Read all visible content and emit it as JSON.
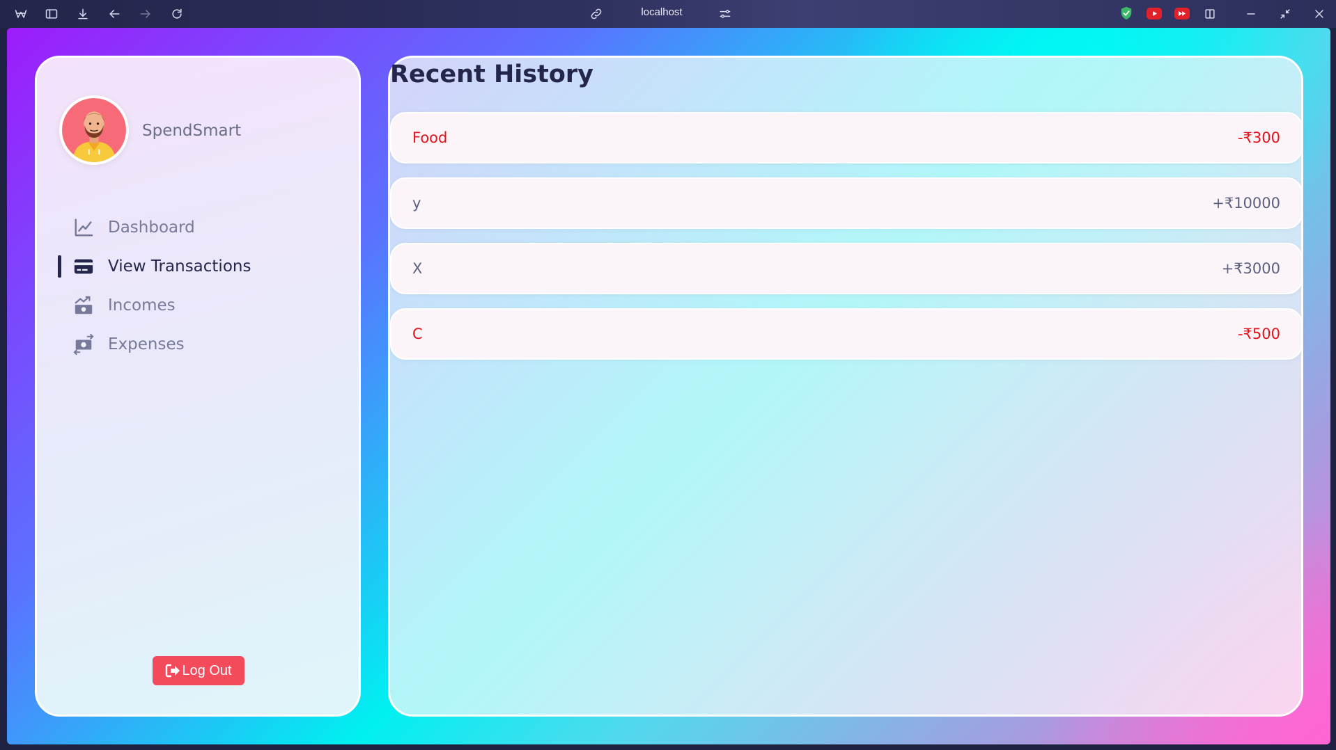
{
  "browser": {
    "url": "localhost"
  },
  "sidebar": {
    "app_name": "SpendSmart",
    "nav": [
      {
        "label": "Dashboard",
        "icon": "chart-line-icon",
        "active": false
      },
      {
        "label": "View Transactions",
        "icon": "credit-card-icon",
        "active": true
      },
      {
        "label": "Incomes",
        "icon": "money-bill-trend-icon",
        "active": false
      },
      {
        "label": "Expenses",
        "icon": "money-bill-transfer-icon",
        "active": false
      }
    ],
    "logout_label": "Log Out"
  },
  "main": {
    "title": "Recent History",
    "transactions": [
      {
        "name": "Food",
        "amount": "-₹300",
        "type": "expense"
      },
      {
        "name": "y",
        "amount": "+₹10000",
        "type": "income"
      },
      {
        "name": "X",
        "amount": "+₹3000",
        "type": "income"
      },
      {
        "name": "C",
        "amount": "-₹500",
        "type": "expense"
      }
    ]
  },
  "colors": {
    "expense": "#e0121a",
    "income": "#5c6080",
    "accent_dark": "#23254d",
    "logout": "#f44b5c"
  }
}
